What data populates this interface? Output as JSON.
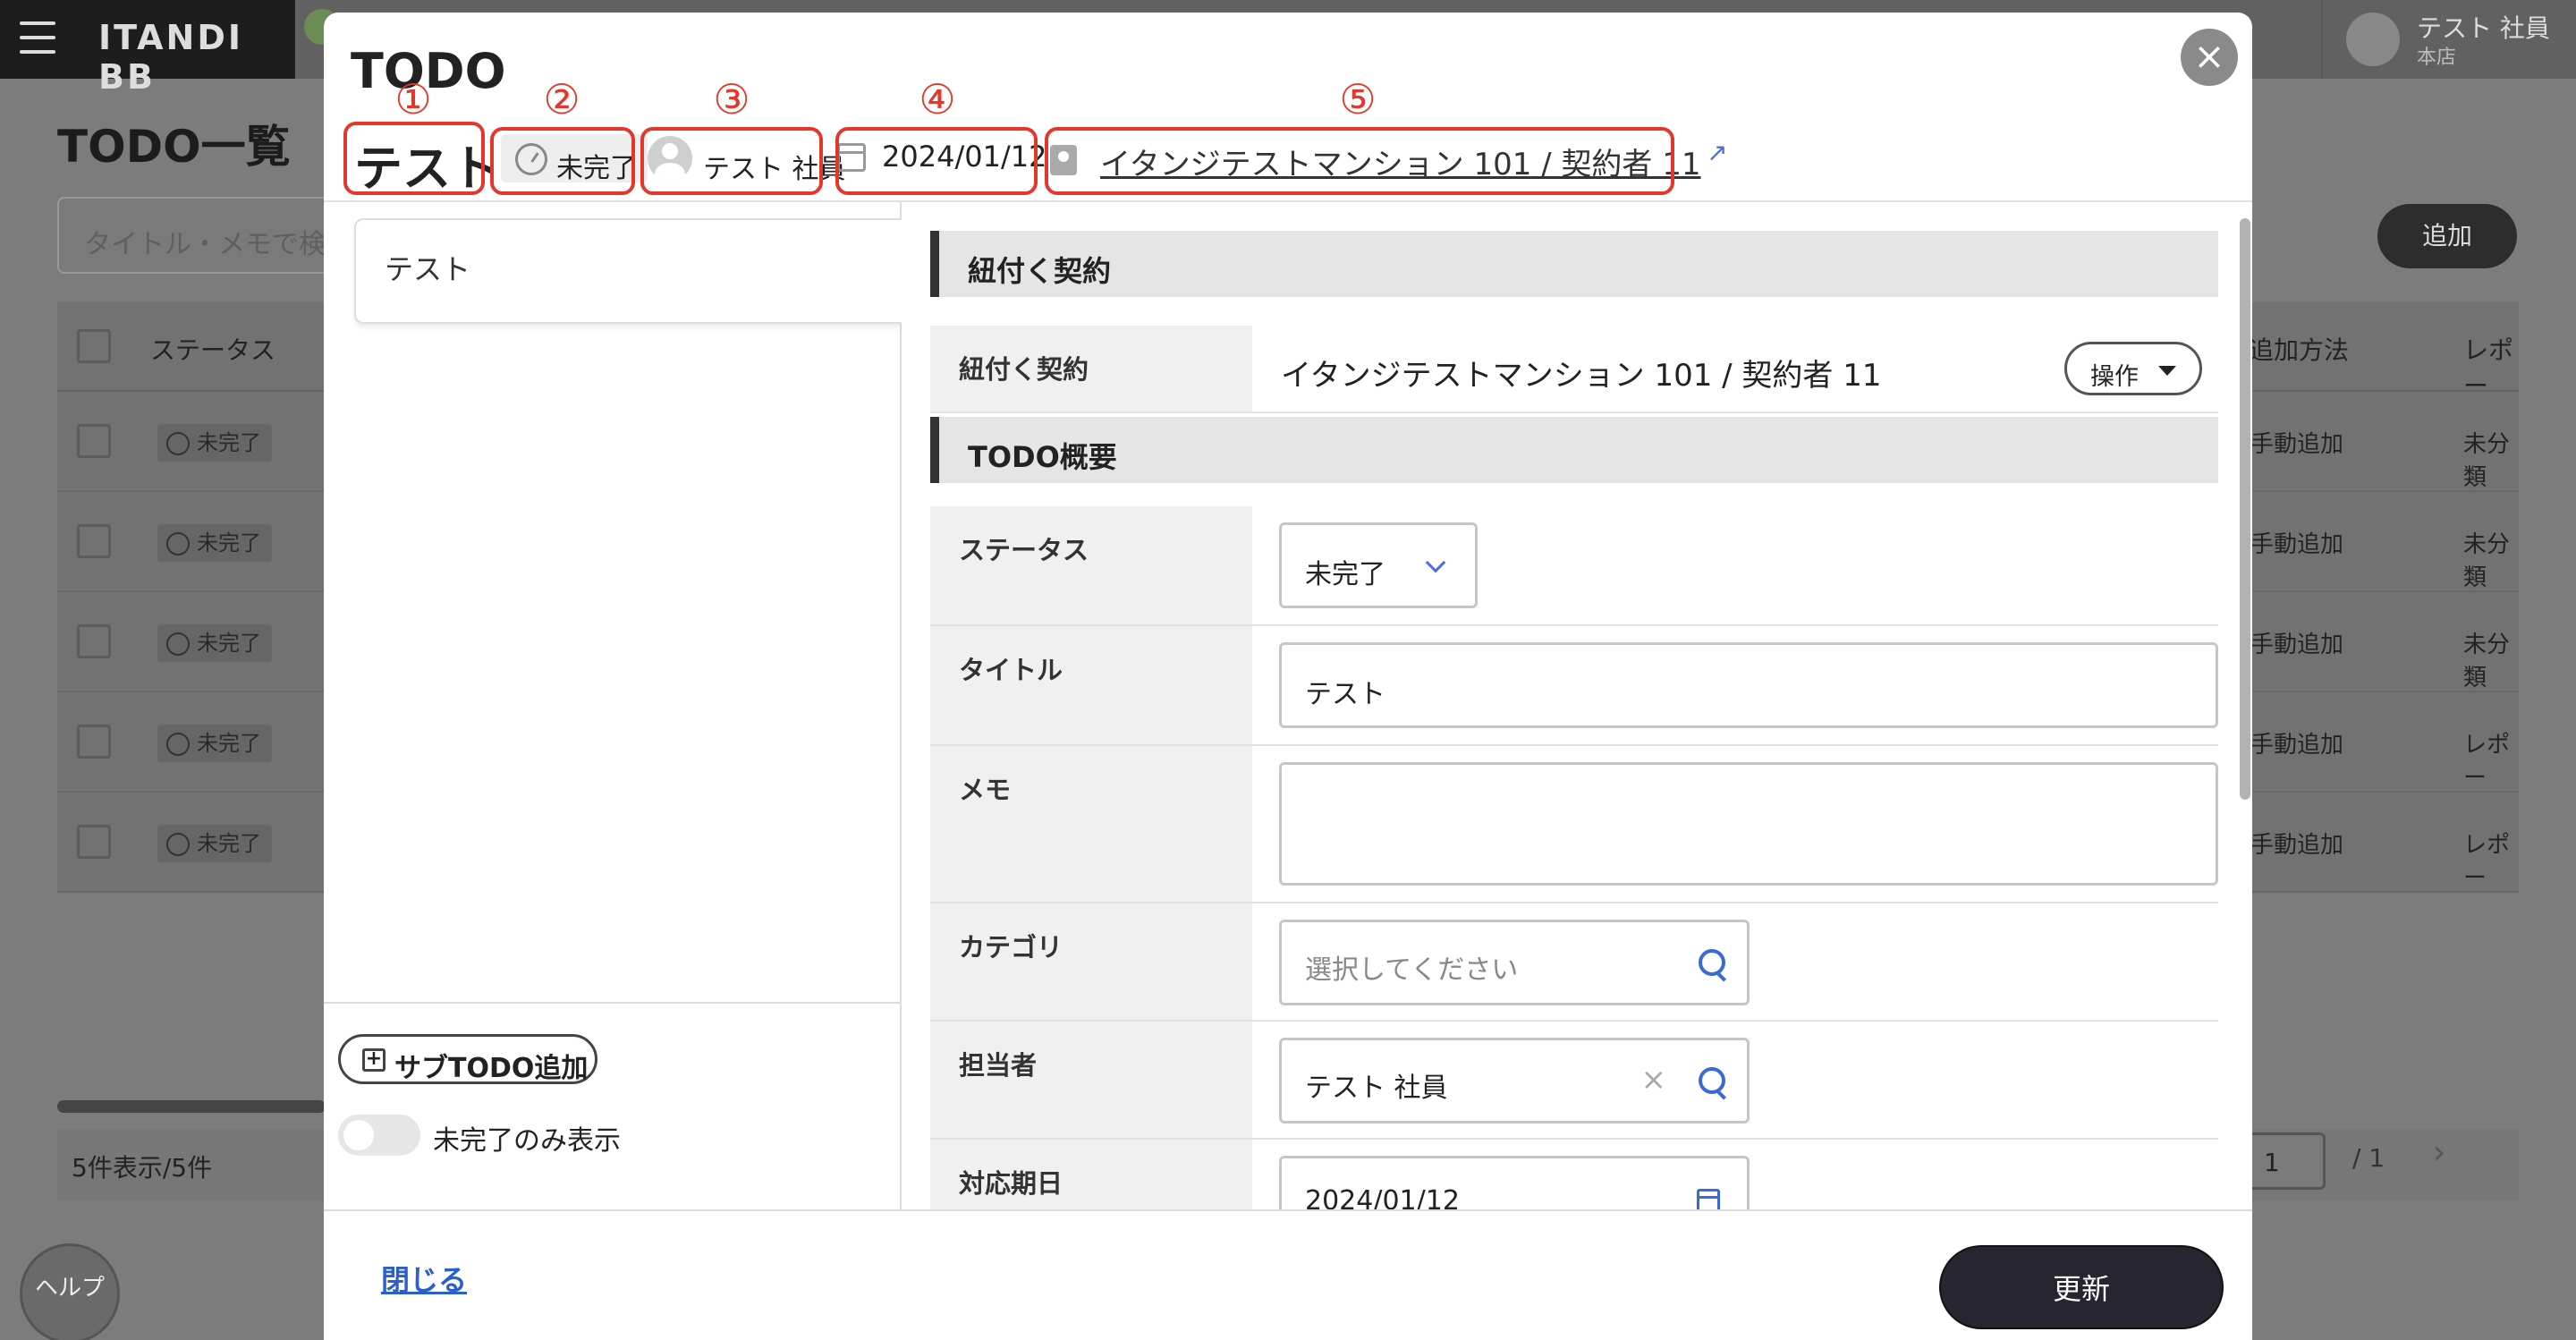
{
  "app": {
    "brand": "ITANDI BB"
  },
  "user": {
    "name": "テスト 社員",
    "store": "本店"
  },
  "background": {
    "page_title": "TODO一覧",
    "search_placeholder": "タイトル・メモで検",
    "add_button": "追加",
    "table_headers": [
      "ステータス",
      "追加方法",
      "レポー"
    ],
    "rows": [
      {
        "status": "未完了",
        "method": "手動追加",
        "report": "未分類"
      },
      {
        "status": "未完了",
        "method": "手動追加",
        "report": "未分類"
      },
      {
        "status": "未完了",
        "method": "手動追加",
        "report": "未分類"
      },
      {
        "status": "未完了",
        "method": "手動追加",
        "report": "レポー"
      },
      {
        "status": "未完了",
        "method": "手動追加",
        "report": "レポー"
      }
    ],
    "count_text": "5件表示/5件",
    "page": "1",
    "page_total": "/ 1",
    "help": "ヘルプ"
  },
  "modal": {
    "title": "TODO",
    "close_icon": "×",
    "annotations": [
      "①",
      "②",
      "③",
      "④",
      "⑤"
    ],
    "header": {
      "todo_title": "テスト",
      "status": "未完了",
      "assignee": "テスト 社員",
      "due_date": "2024/01/12",
      "contract_link": "イタンジテストマンション 101 / 契約者 11"
    },
    "todo_list": [
      {
        "title": "テスト"
      }
    ],
    "add_subtodo_label": "サブTODO追加",
    "incomplete_only_label": "未完了のみ表示",
    "incomplete_only_enabled": false,
    "sections": {
      "contract": {
        "heading": "紐付く契約",
        "label": "紐付く契約",
        "value": "イタンジテストマンション 101 / 契約者 11",
        "action_label": "操作"
      },
      "overview": {
        "heading": "TODO概要",
        "status_label": "ステータス",
        "status_value": "未完了",
        "title_label": "タイトル",
        "title_value": "テスト",
        "memo_label": "メモ",
        "memo_value": "",
        "category_label": "カテゴリ",
        "category_placeholder": "選択してください",
        "assignee_label": "担当者",
        "assignee_value": "テスト 社員",
        "due_label": "対応期日",
        "due_value": "2024/01/12"
      }
    },
    "footer": {
      "close_label": "閉じる",
      "update_label": "更新"
    }
  },
  "colors": {
    "annotation": "#e4372b",
    "link": "#2a5fd0",
    "primary_button": "#27252f"
  }
}
